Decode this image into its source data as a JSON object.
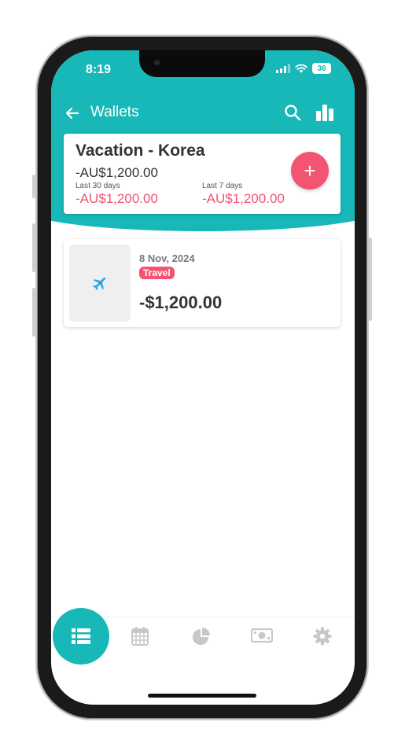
{
  "status_bar": {
    "time": "8:19",
    "battery": "36"
  },
  "app_bar": {
    "title": "Wallets",
    "icons": [
      "arrow-left-icon",
      "search-icon",
      "bar-chart-icon"
    ]
  },
  "wallet": {
    "name": "Vacation - Korea",
    "balance": "-AU$1,200.00",
    "last30_label": "Last 30 days",
    "last30_value": "-AU$1,200.00",
    "last7_label": "Last 7 days",
    "last7_value": "-AU$1,200.00",
    "add_label": "+"
  },
  "transactions": [
    {
      "date": "8 Nov, 2024",
      "category": "Travel",
      "amount": "-$1,200.00",
      "icon": "airplane-icon"
    }
  ],
  "bottom_nav": {
    "items": [
      "list-icon",
      "calendar-icon",
      "pie-chart-icon",
      "money-icon",
      "gear-icon"
    ],
    "active": "list-icon"
  },
  "colors": {
    "primary": "#17b8b7",
    "accent": "#f25471",
    "icon_blue": "#2aa3e6",
    "nav_inactive": "#c8c8c8"
  }
}
